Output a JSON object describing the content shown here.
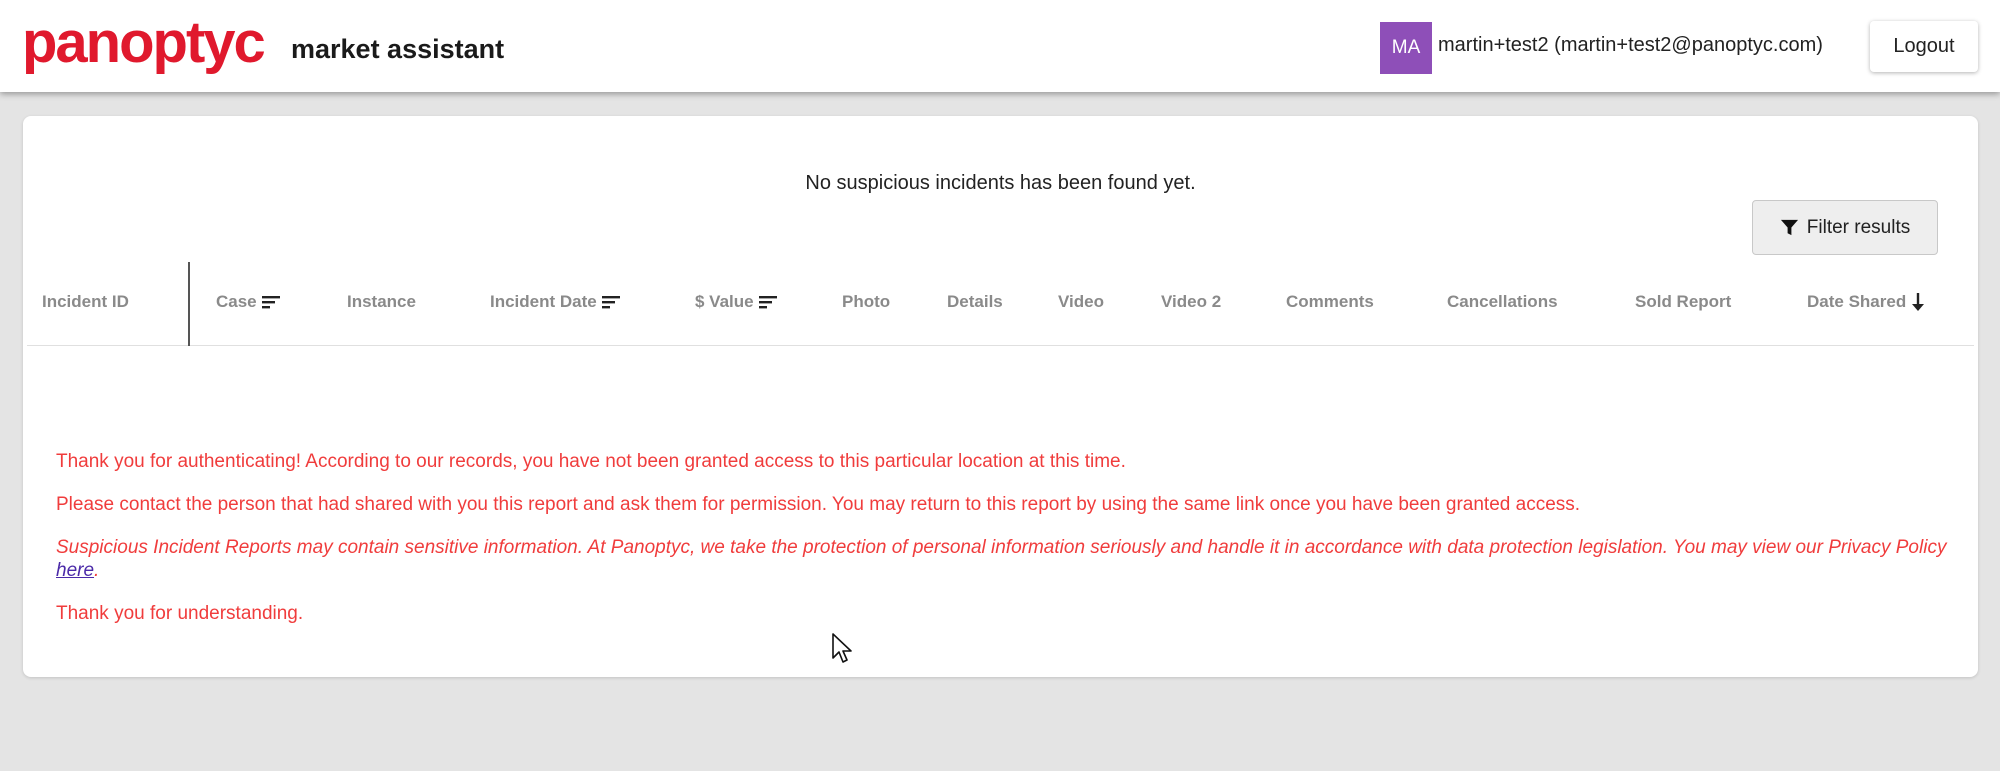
{
  "header": {
    "logo_text": "panoptyc",
    "logo_subtitle": "market assistant",
    "avatar_initials": "MA",
    "user_label": "martin+test2 (martin+test2@panoptyc.com)",
    "logout_label": "Logout"
  },
  "main": {
    "empty_message": "No suspicious incidents has been found yet.",
    "filter_label": "Filter results",
    "columns": [
      {
        "label": "Incident ID"
      },
      {
        "label": "Case"
      },
      {
        "label": "Instance"
      },
      {
        "label": "Incident Date"
      },
      {
        "label": "$ Value"
      },
      {
        "label": "Photo"
      },
      {
        "label": "Details"
      },
      {
        "label": "Video"
      },
      {
        "label": "Video 2"
      },
      {
        "label": "Comments"
      },
      {
        "label": "Cancellations"
      },
      {
        "label": "Sold Report"
      },
      {
        "label": "Date Shared"
      }
    ]
  },
  "notice": {
    "line1": "Thank you for authenticating! According to our records, you have not been granted access to this particular location at this time.",
    "line2": "Please contact the person that had shared with you this report and ask them for permission. You may return to this report by using the same link once you have been granted access.",
    "line3": "Suspicious Incident Reports may contain sensitive information. At Panoptyc, we take the protection of personal information seriously and handle it in accordance with data protection legislation. You may view our Privacy Policy",
    "link_label": "here",
    "line3_end": ".",
    "line4": "Thank you for understanding."
  },
  "colors": {
    "brand_red": "#e0192d",
    "notice_red": "#f03c3c",
    "avatar_purple": "#8e4fb8",
    "link_purple": "#4b2aa8"
  }
}
